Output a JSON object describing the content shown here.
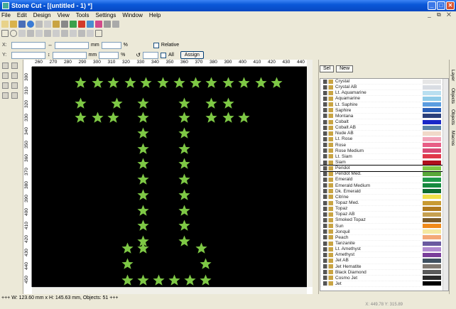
{
  "window": {
    "title": "Stone Cut - [(untitled - 1) *]"
  },
  "menu": [
    "File",
    "Edit",
    "Design",
    "View",
    "Tools",
    "Settings",
    "Window",
    "Help"
  ],
  "mdi_controls": "_ ⧉ ✕",
  "propbar": {
    "x_label": "X:",
    "y_label": "Y:",
    "unit": "mm",
    "percent": "%",
    "relative_label": "Relative",
    "all_label": "All",
    "assign_button": "Assign"
  },
  "ruler": {
    "h": [
      "260",
      "270",
      "280",
      "290",
      "300",
      "310",
      "320",
      "330",
      "340",
      "350",
      "360",
      "370",
      "380",
      "390",
      "400",
      "410",
      "420",
      "430",
      "440"
    ],
    "v": [
      "300",
      "310",
      "320",
      "330",
      "340",
      "350",
      "360",
      "370",
      "380",
      "390",
      "400",
      "410",
      "420",
      "430",
      "440",
      "450"
    ]
  },
  "panel": {
    "sel_button": "Sel",
    "new_button": "New",
    "tabs": [
      "Layer",
      "Objects",
      "Objects",
      "Macros"
    ]
  },
  "colors": [
    {
      "name": "Crystal",
      "hex": "#e6e6e6"
    },
    {
      "name": "Crystal AB",
      "hex": "#d9dde3"
    },
    {
      "name": "Lt. Aquamarine",
      "hex": "#b9dff0"
    },
    {
      "name": "Aquamarine",
      "hex": "#8fcbe8"
    },
    {
      "name": "Lt. Saphire",
      "hex": "#5b9de0"
    },
    {
      "name": "Saphire",
      "hex": "#2a5fb8"
    },
    {
      "name": "Montana",
      "hex": "#2a3f7a"
    },
    {
      "name": "Cobalt",
      "hex": "#1a28c8"
    },
    {
      "name": "Cobalt AB",
      "hex": "#5b84a8"
    },
    {
      "name": "Nude AB",
      "hex": "#f1d9c9"
    },
    {
      "name": "Lt. Rose",
      "hex": "#f2a2b8"
    },
    {
      "name": "Rose",
      "hex": "#e85e86"
    },
    {
      "name": "Rose Medium",
      "hex": "#d84a75"
    },
    {
      "name": "Lt. Siam",
      "hex": "#e0384a"
    },
    {
      "name": "Siam",
      "hex": "#b0101e"
    },
    {
      "name": "Peridot",
      "hex": "#7ec845"
    },
    {
      "name": "Peridot Med.",
      "hex": "#5aa83a"
    },
    {
      "name": "Emerald",
      "hex": "#1f9a4a"
    },
    {
      "name": "Emerald Medium",
      "hex": "#168a3f"
    },
    {
      "name": "Dk. Emerald",
      "hex": "#0d6c30"
    },
    {
      "name": "Citrine",
      "hex": "#f0e04a"
    },
    {
      "name": "Topaz Med.",
      "hex": "#c89a32"
    },
    {
      "name": "Topaz",
      "hex": "#b07a1e"
    },
    {
      "name": "Topaz AB",
      "hex": "#c6a050"
    },
    {
      "name": "Smoked Topaz",
      "hex": "#7a5a28"
    },
    {
      "name": "Sun",
      "hex": "#f08a1a"
    },
    {
      "name": "Jonquil",
      "hex": "#f4e8a2"
    },
    {
      "name": "Peach",
      "hex": "#f4a878"
    },
    {
      "name": "Tanzanite",
      "hex": "#6a5aa0"
    },
    {
      "name": "Lt. Amethyst",
      "hex": "#b08ad0"
    },
    {
      "name": "Amethyst",
      "hex": "#7a3e9a"
    },
    {
      "name": "Jet AB",
      "hex": "#405060"
    },
    {
      "name": "Jet Hematite",
      "hex": "#807870"
    },
    {
      "name": "Black Diamond",
      "hex": "#5a5a5a"
    },
    {
      "name": "Cosmo Jet",
      "hex": "#2a2a2a"
    },
    {
      "name": "Jet",
      "hex": "#000000"
    }
  ],
  "selected_color": "Peridot",
  "star_color": "#7ec845",
  "status": "+++ W: 123.60 mm x H: 145.63 mm, Objects: 51 +++",
  "coords": "X: 449.78  Y: 315.89"
}
